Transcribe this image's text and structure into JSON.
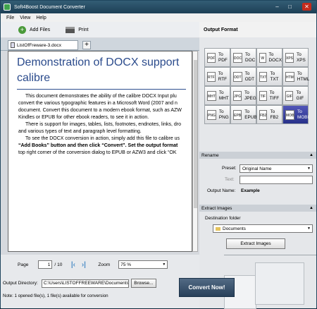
{
  "window": {
    "title": "Soft4Boost Document Converter"
  },
  "menu": [
    "File",
    "View",
    "Help"
  ],
  "toolbar": {
    "add_files": "Add Files",
    "print": "Print"
  },
  "tabs": {
    "active": "ListOfFreware-3.docx",
    "add": "+"
  },
  "document": {
    "heading_line1": "Demonstration of DOCX support",
    "heading_line2": "calibre",
    "lines": [
      "This document demonstrates the ability of the calibre DOCX Input plu",
      "convert the various typographic features in a Microsoft Word (2007 and n",
      "document. Convert this document to a modern ebook format, such as AZW",
      "Kindles or EPUB for other ebook readers, to see it in action.",
      "There is support for images, tables, lists, footnotes, endnotes, links, dro",
      "and various types of text and paragraph level formatting.",
      "To see the DOCX conversion in action, simply add this file to calibre us",
      "“Add Books” button and then click “Convert”. Set the output format",
      "top right corner of the conversion dialog to EPUB or AZW3 and click “OK"
    ]
  },
  "navigation": {
    "page_label": "Page",
    "page_value": "1",
    "page_total": "/ 10",
    "zoom_label": "Zoom",
    "zoom_value": "75 %"
  },
  "output": {
    "directory_label": "Output Directory:",
    "directory_value": "C:\\Users\\LISTOFFREEWARE\\Documents\\o",
    "browse": "Browse...",
    "convert": "Convert Now!"
  },
  "status": "Note: 1 opened file(s), 1 file(s) available for conversion",
  "right_panel": {
    "title": "Output Format",
    "formats": [
      {
        "label": "To PDF",
        "icon": "PDF"
      },
      {
        "label": "To DOC",
        "icon": "DOC"
      },
      {
        "label": "To DOCX",
        "icon": "W"
      },
      {
        "label": "To XPS",
        "icon": "XPS"
      },
      {
        "label": "To RTF",
        "icon": "RTF"
      },
      {
        "label": "To ODT",
        "icon": "ODT"
      },
      {
        "label": "To TXT",
        "icon": "TXT"
      },
      {
        "label": "To HTML",
        "icon": "HTM"
      },
      {
        "label": "To MHT",
        "icon": "MHT"
      },
      {
        "label": "To JPEG",
        "icon": "JPG"
      },
      {
        "label": "To TIFF",
        "icon": "TIF"
      },
      {
        "label": "To GIF",
        "icon": "GIF"
      },
      {
        "label": "To PNG",
        "icon": "PNG"
      },
      {
        "label": "To EPUB",
        "icon": "EPB"
      },
      {
        "label": "To FB2",
        "icon": "FB2"
      },
      {
        "label": "To MOBI",
        "icon": "MOB",
        "selected": true
      }
    ],
    "rename": {
      "section": "Rename",
      "preset_label": "Preset:",
      "preset_value": "Original Name",
      "text_label": "Text:",
      "output_name_label": "Output Name:",
      "output_name_value": "Example"
    },
    "extract": {
      "section": "Extract Images",
      "dest_label": "Destination folder",
      "dest_value": "Documents",
      "button": "Extract Images"
    }
  }
}
